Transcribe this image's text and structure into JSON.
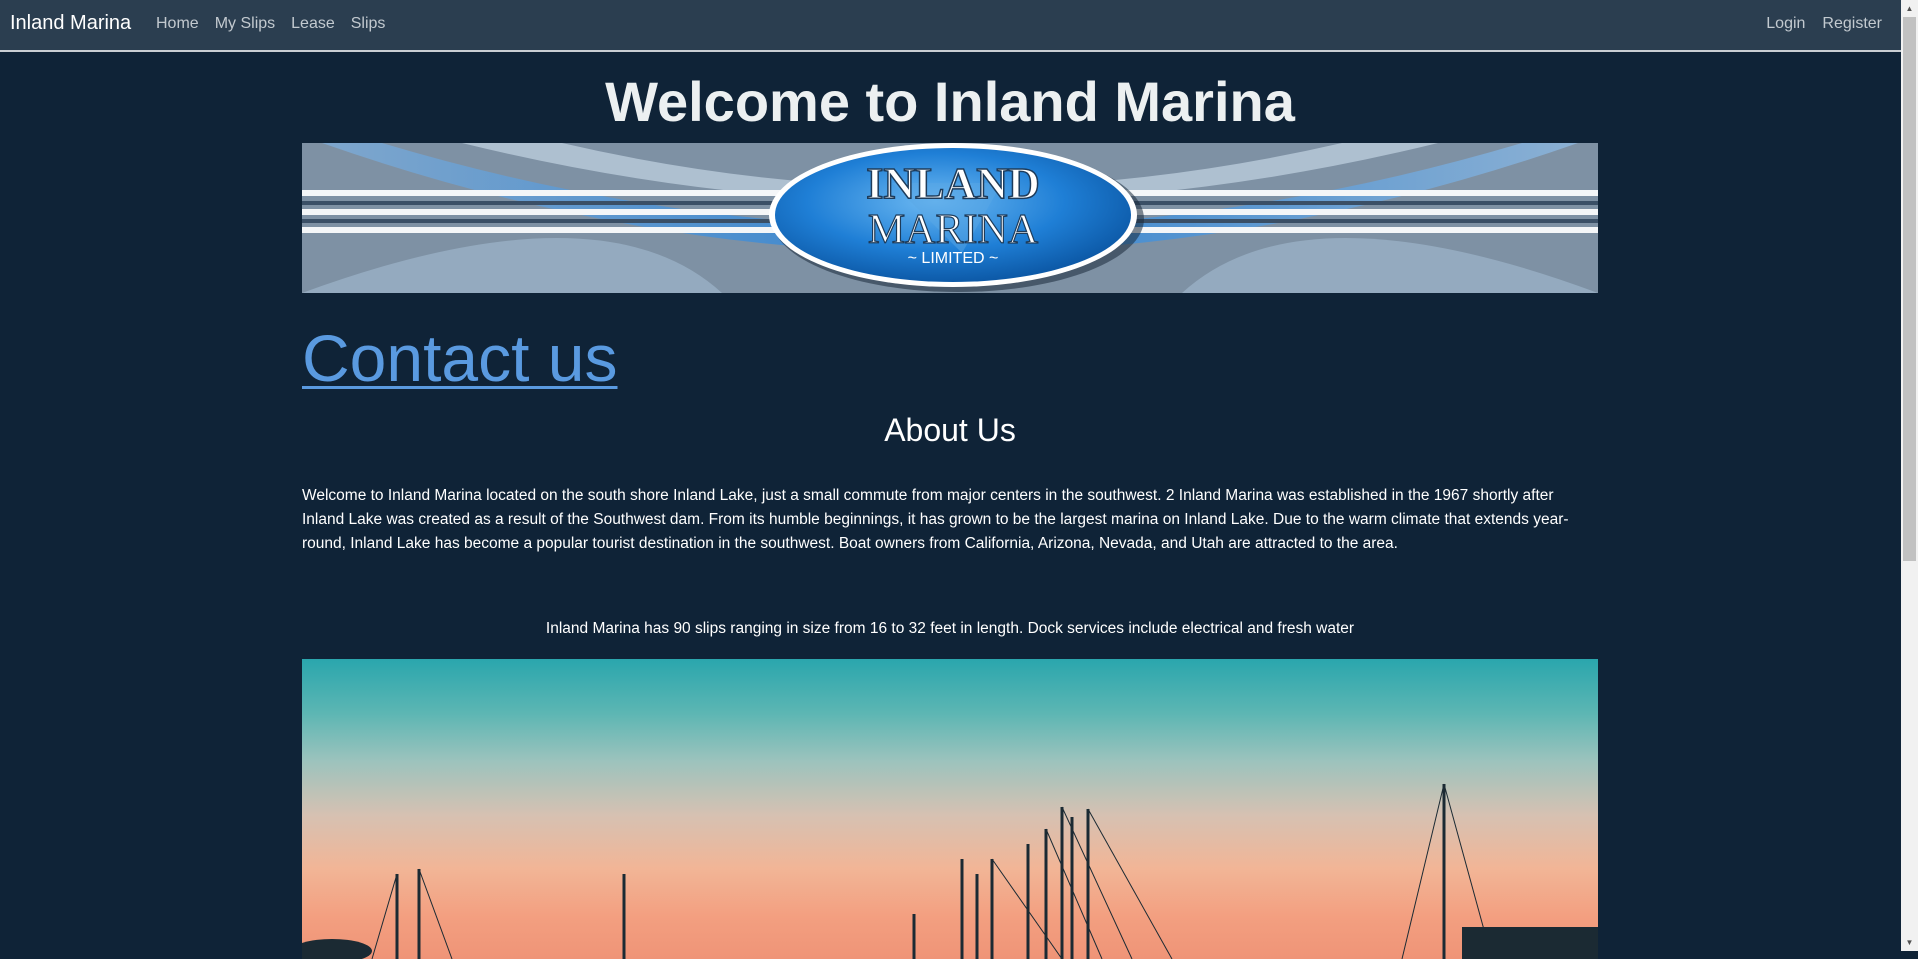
{
  "navbar": {
    "brand": "Inland Marina",
    "links": [
      "Home",
      "My Slips",
      "Lease",
      "Slips"
    ],
    "right_links": [
      "Login",
      "Register"
    ]
  },
  "main": {
    "title": "Welcome to Inland Marina",
    "banner_logo": {
      "line1": "INLAND",
      "line2": "MARINA",
      "line3": "~ LIMITED ~"
    },
    "contact_link": "Contact us",
    "about_title": "About Us",
    "about_text": "Welcome to Inland Marina located on the south shore Inland Lake, just a small commute from major centers in the southwest. 2 Inland Marina was established in the 1967 shortly after Inland Lake was created as a result of the Southwest dam. From its humble beginnings, it has grown to be the largest marina on Inland Lake. Due to the warm climate that extends year-round, Inland Lake has become a popular tourist destination in the southwest. Boat owners from California, Arizona, Nevada, and Utah are attracted to the area.",
    "slips_text": "Inland Marina has 90 slips ranging in size from 16 to 32 feet in length. Dock services include electrical and fresh water"
  },
  "colors": {
    "background": "#0f2337",
    "navbar": "#2b3e50",
    "link": "#5a9ae0"
  }
}
